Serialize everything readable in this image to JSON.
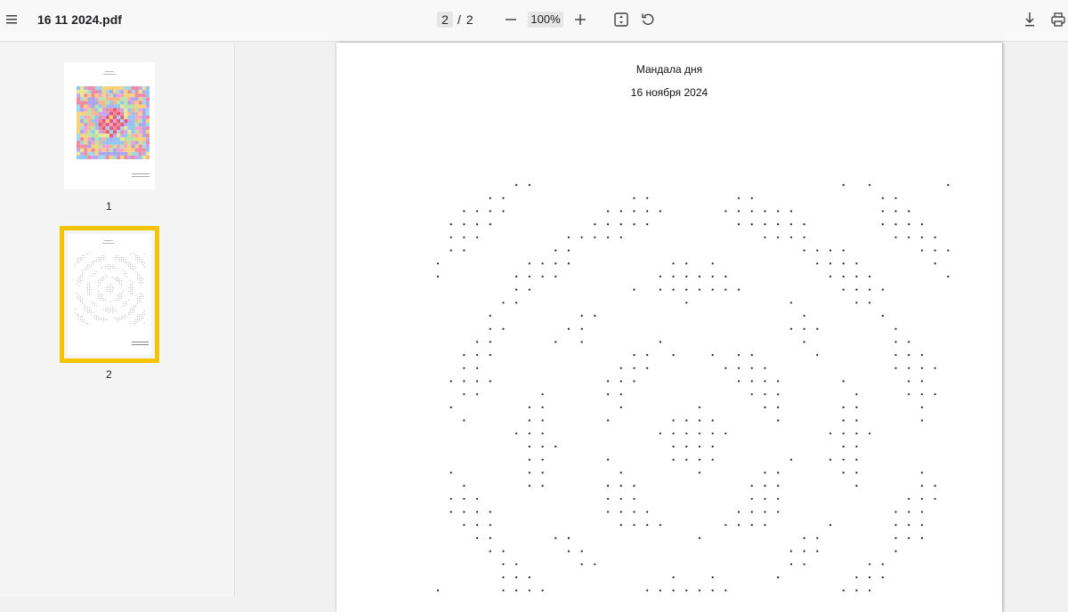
{
  "toolbar": {
    "menu_icon": "hamburger-menu-icon",
    "file_name": "16 11 2024.pdf",
    "current_page": "2",
    "page_separator": "/",
    "total_pages": "2",
    "zoom_level": "100%",
    "zoom_out_icon": "minus-icon",
    "zoom_in_icon": "plus-icon",
    "fit_icon": "fit-to-page-icon",
    "rotate_icon": "rotate-counterclockwise-icon",
    "download_icon": "download-icon",
    "print_icon": "printer-icon"
  },
  "sidebar": {
    "thumbnails": [
      {
        "label": "1",
        "selected": false
      },
      {
        "label": "2",
        "selected": true
      }
    ],
    "selection_color": "#f5c400"
  },
  "document": {
    "title": "Мандала дня",
    "date": "16 ноября 2024"
  },
  "colors": {
    "toolbar_bg": "#f8f8f8",
    "sidebar_bg": "#f4f4f4",
    "viewer_bg": "#f1f1f1",
    "accent": "#f5c400"
  }
}
